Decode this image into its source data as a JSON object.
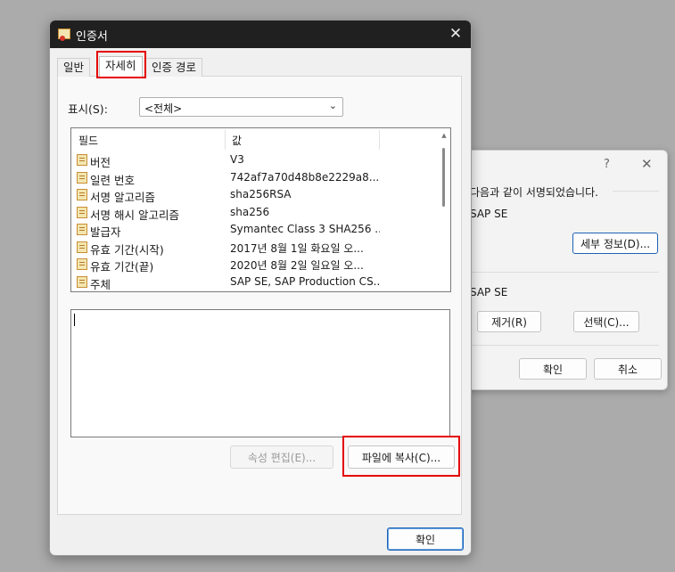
{
  "bg_dialog": {
    "help_glyph": "?",
    "close_glyph": "✕",
    "sign_text": "다음과 같이 서명되었습니다.",
    "signer_name": "SAP SE",
    "details_button": "세부 정보(D)...",
    "signer_name2": "SAP SE",
    "remove_button": "제거(R)",
    "select_button": "선택(C)...",
    "ok_button": "확인",
    "cancel_button": "취소"
  },
  "dialog": {
    "title": "인증서",
    "close_glyph": "✕",
    "tabs": [
      "일반",
      "자세히",
      "인증 경로"
    ],
    "active_tab": "자세히",
    "show_label": "표시(S):",
    "show_value": "<전체>",
    "columns": {
      "field": "필드",
      "value": "값"
    },
    "fields": [
      {
        "field": "버전",
        "value": "V3"
      },
      {
        "field": "일련 번호",
        "value": "742af7a70d48b8e2229a8..."
      },
      {
        "field": "서명 알고리즘",
        "value": "sha256RSA"
      },
      {
        "field": "서명 해시 알고리즘",
        "value": "sha256"
      },
      {
        "field": "발급자",
        "value": "Symantec Class 3 SHA256 ..."
      },
      {
        "field": "유효 기간(시작)",
        "value": "2017년 8월 1일 화요일 오..."
      },
      {
        "field": "유효 기간(끝)",
        "value": "2020년 8월 2일 일요일 오..."
      },
      {
        "field": "주체",
        "value": "SAP SE, SAP Production CS..."
      }
    ],
    "edit_properties_button": "속성 편집(E)...",
    "copy_to_file_button": "파일에 복사(C)...",
    "ok_button": "확인"
  }
}
